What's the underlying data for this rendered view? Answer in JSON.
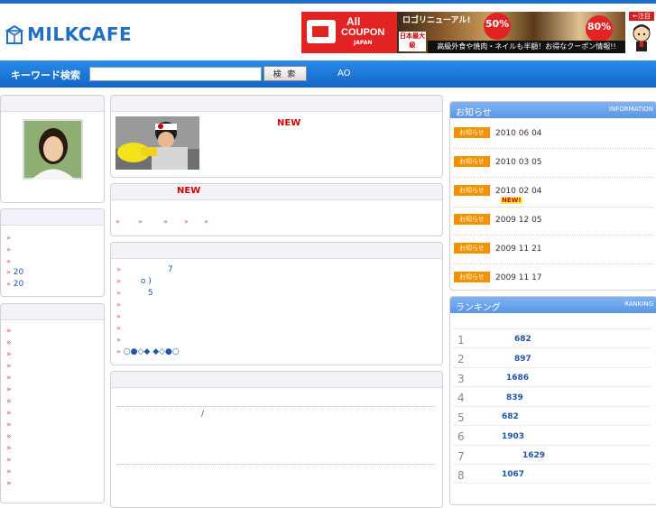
{
  "brand": {
    "name": "MILKCAFE",
    "color": "#1f6fc4"
  },
  "ad": {
    "all": "All",
    "coupon": "COUPON",
    "japan": "JAPAN",
    "renew": "ロゴリニューアル!",
    "pct1": "50%",
    "pct2": "80%",
    "nihon": "日本最大級",
    "bottom": "高級外食や焼肉・ネイルも半額！お得なクーポン情報!!",
    "side_tag": "←注目"
  },
  "search": {
    "label": "キーワード検索",
    "value": "",
    "button": "検 索",
    "extra": "AO"
  },
  "center": {
    "feature_new": "NEW",
    "box2_new": "NEW",
    "box2_links": [
      "»",
      "»",
      "»",
      "»",
      "»"
    ],
    "box3_items": [
      {
        "arrow": "»",
        "text": "7"
      },
      {
        "arrow": "»",
        "text": "o )"
      },
      {
        "arrow": "»",
        "text": "5"
      },
      {
        "arrow": "»",
        "text": ""
      },
      {
        "arrow": "»",
        "text": ""
      },
      {
        "arrow": "»",
        "text": ""
      },
      {
        "arrow": "»",
        "text": ""
      },
      {
        "arrow": "»",
        "text": "○●◇◆  ◆◇●○"
      }
    ],
    "box4_slash": "/"
  },
  "left": {
    "box2_items": [
      {
        "arrow": "»",
        "text": ""
      },
      {
        "arrow": "»",
        "text": ""
      },
      {
        "arrow": "»",
        "text": ""
      },
      {
        "arrow": "»",
        "text": "20"
      },
      {
        "arrow": "»",
        "text": "20"
      }
    ],
    "box3_arrows": [
      "»",
      "»",
      "»",
      "»",
      "»",
      "»",
      "»",
      "»",
      "»",
      "»",
      "»",
      "»",
      "»",
      "»"
    ]
  },
  "news": {
    "title": "お知らせ",
    "en": "INFORMATION",
    "badge": "お知らせ",
    "new_mark": "NEW!",
    "items": [
      "2010 06 04",
      "2010 03 05",
      "2010 02 04",
      "2009 12 05",
      "2009 11 21",
      "2009 11 17"
    ]
  },
  "ranking": {
    "title": "ランキング",
    "en": "RANKING",
    "items": [
      {
        "rank": "1",
        "value": "682"
      },
      {
        "rank": "2",
        "value": "897"
      },
      {
        "rank": "3",
        "value": "1686"
      },
      {
        "rank": "4",
        "value": "839"
      },
      {
        "rank": "5",
        "value": "682"
      },
      {
        "rank": "6",
        "value": "1903"
      },
      {
        "rank": "7",
        "value": "1629"
      },
      {
        "rank": "8",
        "value": "1067"
      }
    ]
  }
}
